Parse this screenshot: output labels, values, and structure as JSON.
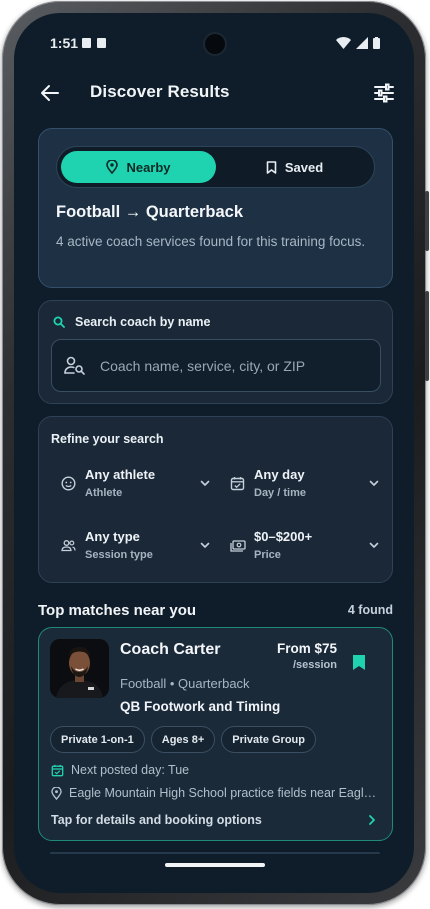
{
  "status_bar": {
    "time": "1:51"
  },
  "app_bar": {
    "title": "Discover Results"
  },
  "toggle": {
    "nearby_label": "Nearby",
    "saved_label": "Saved",
    "heading": "Football → Quarterback",
    "subtext": "4 active coach services found for this training focus."
  },
  "search": {
    "label": "Search coach by name",
    "placeholder": "Coach name, service, city, or ZIP"
  },
  "refine": {
    "label": "Refine your search",
    "filters": [
      {
        "value": "Any athlete",
        "caption": "Athlete",
        "icon": "face-icon"
      },
      {
        "value": "Any day",
        "caption": "Day / time",
        "icon": "calendar-icon"
      },
      {
        "value": "Any type",
        "caption": "Session type",
        "icon": "group-icon"
      },
      {
        "value": "$0–$200+",
        "caption": "Price",
        "icon": "cash-icon"
      }
    ]
  },
  "results": {
    "title": "Top matches near you",
    "count": "4 found",
    "cards": [
      {
        "name": "Coach Carter",
        "price": "From $75",
        "per": "/session",
        "sport": "Football • Quarterback",
        "service": "QB Footwork and Timing",
        "chips": [
          "Private 1-on-1",
          "Ages 8+",
          "Private Group"
        ],
        "next_day": "Next posted day: Tue",
        "location": "Eagle Mountain High School practice fields near Eagle Mountain",
        "cta": "Tap for details and booking options"
      }
    ]
  },
  "colors": {
    "accent": "#20d3b0",
    "background": "#0f1d2a",
    "card": "#1a2837"
  }
}
